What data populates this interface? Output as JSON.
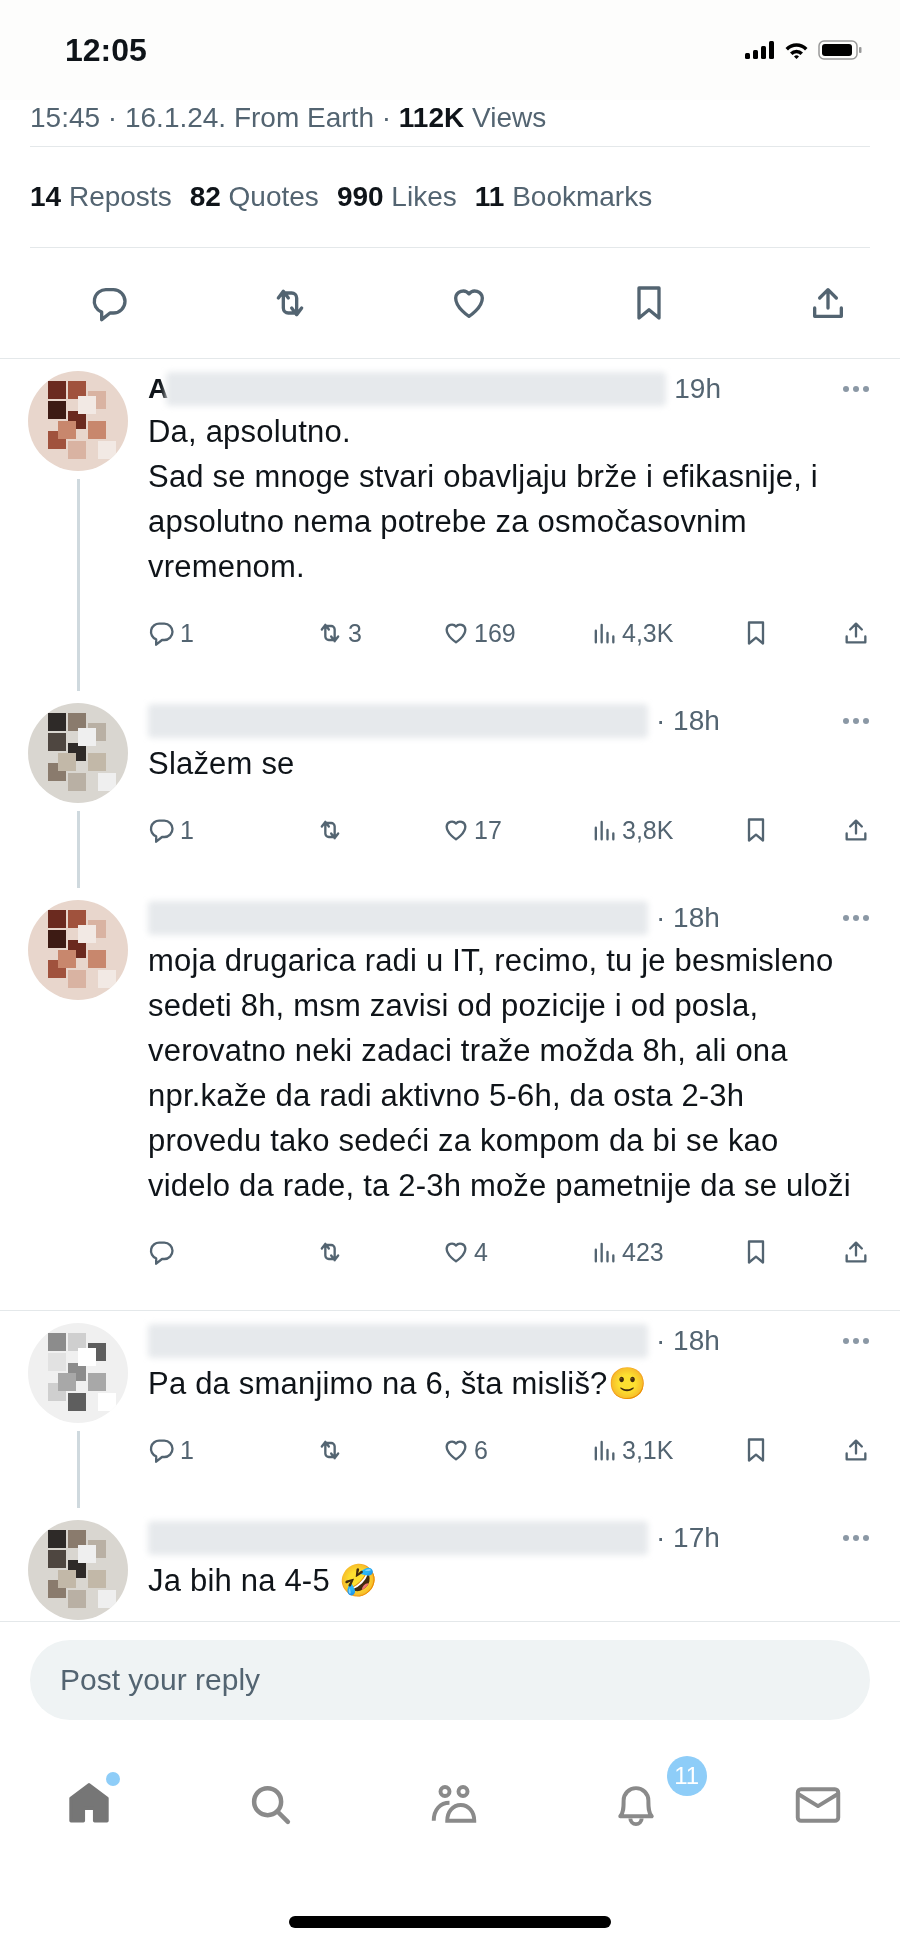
{
  "status_bar": {
    "time": "12:05"
  },
  "post": {
    "meta": "15:45 · 16.1.24. From Earth · **112K** Views",
    "stats": [
      "**14** Reposts",
      "**82** Quotes",
      "**990** Likes",
      "**11** Bookmarks"
    ],
    "actions": [
      {
        "kind": "reply"
      },
      {
        "kind": "repost"
      },
      {
        "kind": "like"
      },
      {
        "kind": "bookmark"
      },
      {
        "kind": "share"
      }
    ]
  },
  "replies": [
    {
      "name_initial": "A",
      "time": "19h",
      "text": "Da, apsolutno.\nSad se mnoge stvari obavljaju brže i efikasnije, i apsolutno nema potrebe za osmočasovnim vremenom.",
      "replies": "1",
      "reposts": "3",
      "likes": "169",
      "views": "4,3K",
      "thread_line": true,
      "divider_below": false
    },
    {
      "time": "· 18h",
      "text": "Slažem se",
      "replies": "1",
      "likes": "17",
      "views": "3,8K",
      "thread_line": true,
      "divider_below": false
    },
    {
      "time": "· 18h",
      "text": "moja drugarica radi u IT, recimo, tu je besmisleno sedeti 8h, msm zavisi od pozicije i od posla, verovatno neki zadaci traže možda 8h, ali ona npr.kaže da radi aktivno 5-6h, da osta 2-3h provedu tako sedeći za kompom da bi se kao videlo da rade, ta 2-3h može pametnije da se uloži",
      "likes": "4",
      "views": "423",
      "thread_line": false,
      "divider_below": true
    },
    {
      "time": "· 18h",
      "text": "Pa da smanjimo na 6, šta misliš?🙂",
      "replies": "1",
      "likes": "6",
      "views": "3,1K",
      "thread_line": true,
      "divider_below": false
    },
    {
      "time": "· 17h",
      "text": "Ja bih na 4-5 🤣",
      "thread_line": false,
      "divider_below": true,
      "actions_hidden": true
    }
  ],
  "reply_field": {
    "placeholder": "Post your reply"
  },
  "nav": [
    {
      "kind": "home",
      "selected": true,
      "dot": true
    },
    {
      "kind": "search",
      "selected": false
    },
    {
      "kind": "communities",
      "selected": false
    },
    {
      "kind": "notifications",
      "selected": false,
      "badge": "11"
    },
    {
      "kind": "messages",
      "selected": false
    }
  ]
}
